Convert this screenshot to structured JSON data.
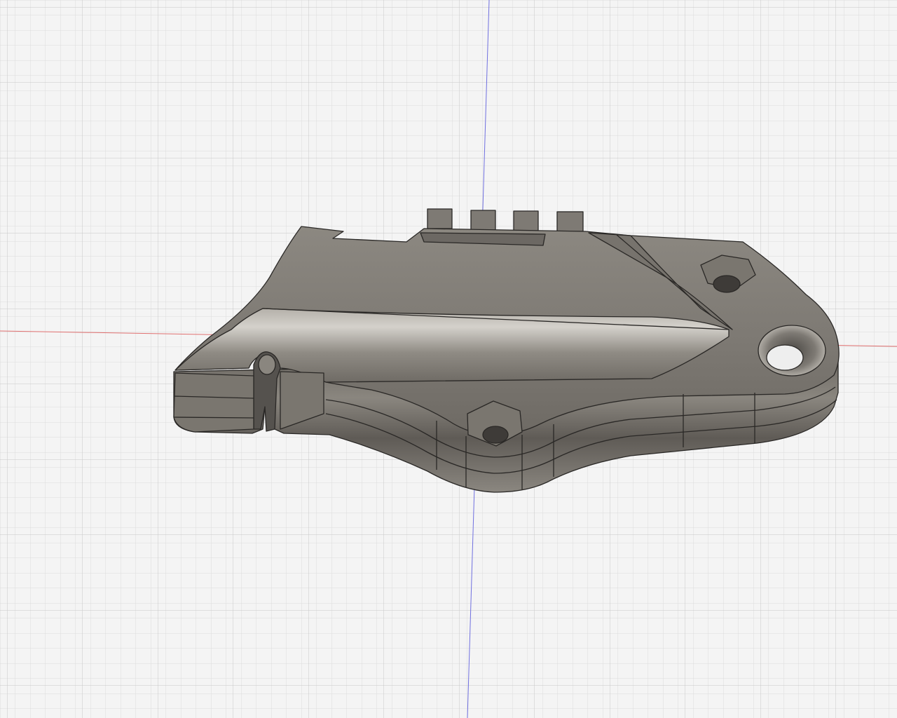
{
  "viewport": {
    "background": "#f4f4f4",
    "grid_minor_color": "#dcdcdc",
    "grid_major_color": "#c6c6c6",
    "axis_x_color": "#e07070",
    "axis_y_color": "#7070e0"
  },
  "model": {
    "body_color": "#85817b",
    "edge_color": "#2a2826",
    "features": [
      "hex-nut-pocket",
      "hex-nut-pocket",
      "countersunk-hole",
      "cable-slot",
      "tab",
      "tab",
      "tab",
      "tab"
    ]
  }
}
